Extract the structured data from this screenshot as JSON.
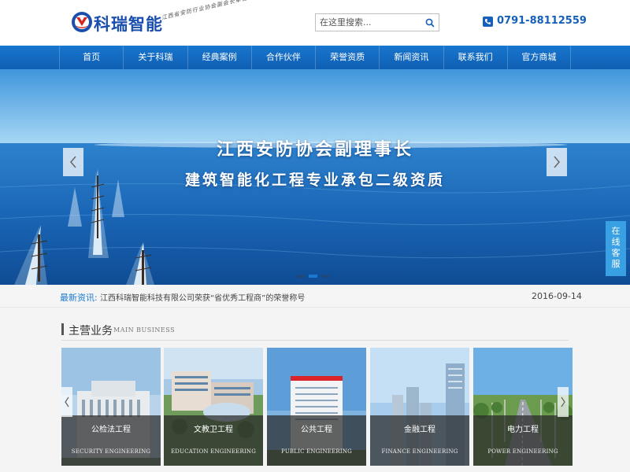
{
  "header": {
    "logo_text": "科瑞智能",
    "slogan": "江西省安防行业协会副会长单位",
    "search_placeholder": "在这里搜索...",
    "phone": "0791-88112559"
  },
  "nav": {
    "items": [
      {
        "label": "首页"
      },
      {
        "label": "关于科瑞"
      },
      {
        "label": "经典案例"
      },
      {
        "label": "合作伙伴"
      },
      {
        "label": "荣誉资质"
      },
      {
        "label": "新闻资讯"
      },
      {
        "label": "联系我们"
      },
      {
        "label": "官方商城"
      }
    ]
  },
  "banner": {
    "line1": "江西安防协会副理事长",
    "line2": "建筑智能化工程专业承包二级资质",
    "slides": 3,
    "active_slide": 2
  },
  "kefu": {
    "chars": [
      "在",
      "线",
      "客",
      "服"
    ]
  },
  "news": {
    "label": "最新资讯:",
    "headline": "江西科瑞智能科技有限公司荣获“省优秀工程商”的荣誉称号",
    "date": "2016-09-14"
  },
  "section": {
    "title": "主营业务",
    "subtitle": "MAIN BUSINESS"
  },
  "cards": [
    {
      "title": "公检法工程",
      "subtitle": "SECURITY ENGINEERING"
    },
    {
      "title": "文教卫工程",
      "subtitle": "EDUCATION ENGINEERING"
    },
    {
      "title": "公共工程",
      "subtitle": "PUBLIC ENGINEERING"
    },
    {
      "title": "金融工程",
      "subtitle": "FINANCE ENGINEERING"
    },
    {
      "title": "电力工程",
      "subtitle": "POWER ENGINEERING"
    }
  ],
  "colors": {
    "brand_blue": "#1560b8",
    "nav_blue": "#1976cf",
    "accent": "#1a7ad0"
  }
}
